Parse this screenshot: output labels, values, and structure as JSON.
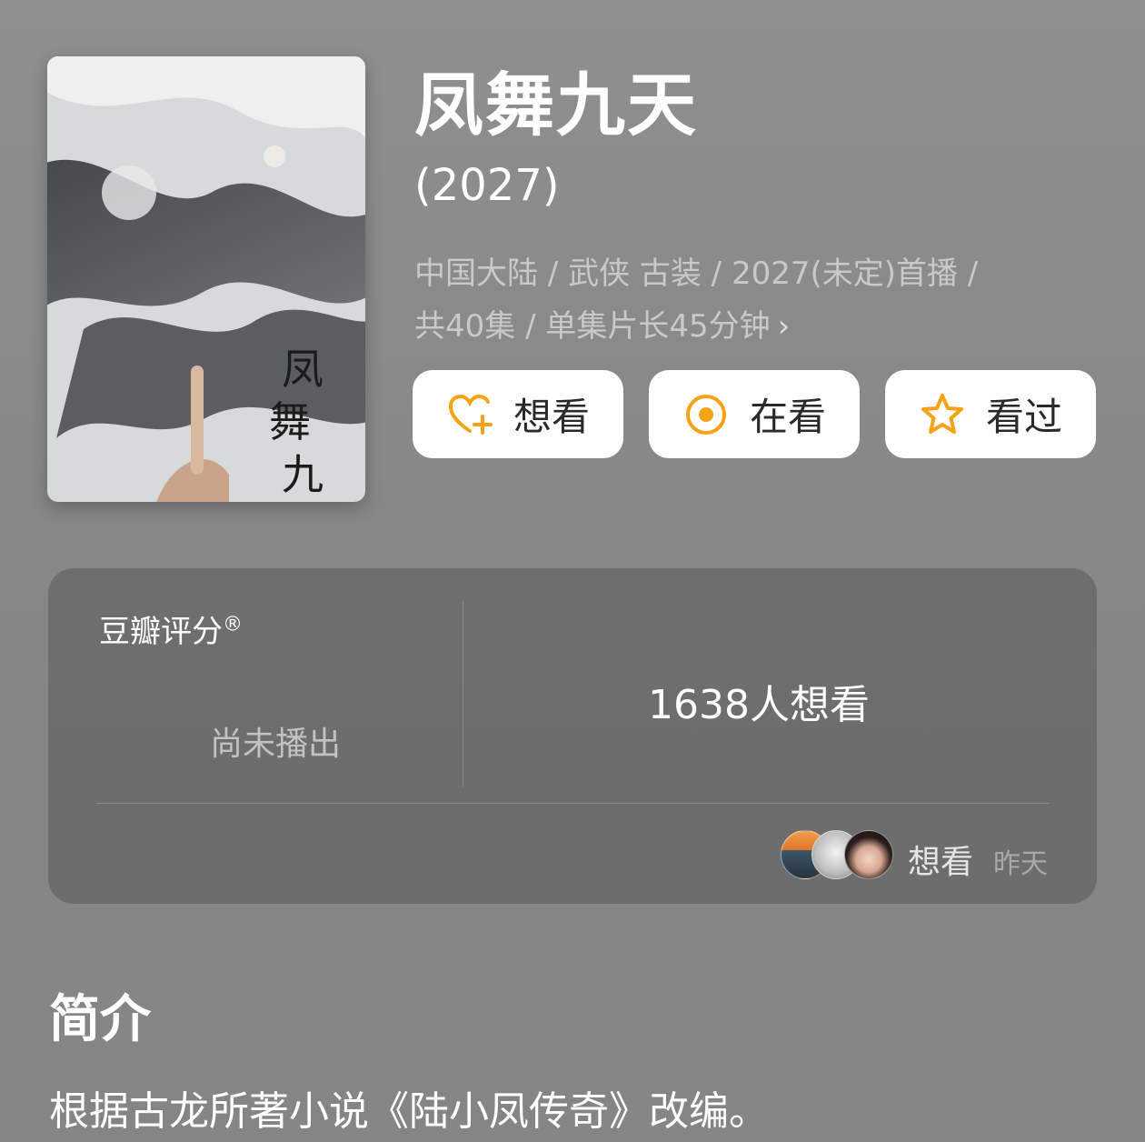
{
  "show": {
    "title": "凤舞九天",
    "year": "(2027)",
    "meta_line1": "中国大陆 / 武侠 古装 / 2027(未定)首播 /",
    "meta_line2": "共40集 / 单集片长45分钟",
    "meta_more": "›"
  },
  "actions": {
    "want_label": "想看",
    "watching_label": "在看",
    "watched_label": "看过"
  },
  "rating": {
    "brand": "豆瓣评分",
    "brand_mark": "®",
    "status": "尚未播出",
    "want_count": "1638人想看",
    "activity": "想看",
    "activity_time": "昨天"
  },
  "summary_section": {
    "title": "简介",
    "text": "根据古龙所著小说《陆小凤传奇》改编。"
  },
  "colors": {
    "accent": "#f5a314",
    "background": "#8a8a8a"
  },
  "icons": {
    "want": "heart-plus-icon",
    "watching": "target-icon",
    "watched": "star-icon"
  }
}
